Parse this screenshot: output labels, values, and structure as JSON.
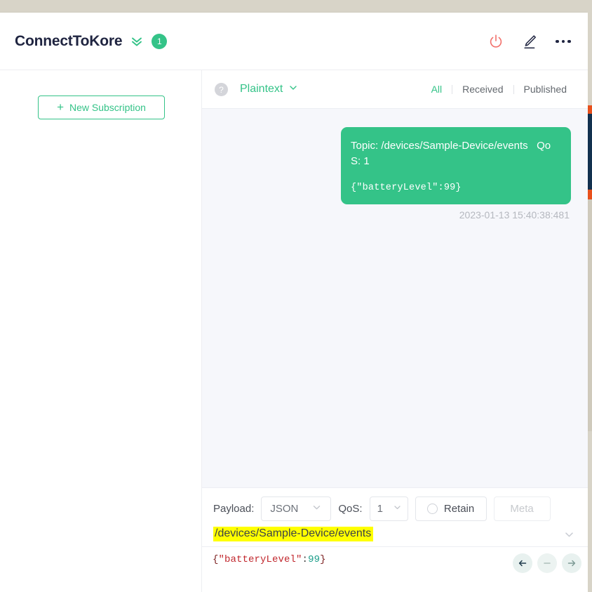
{
  "app": {
    "title": "ConnectToKore",
    "connection_badge": "1",
    "chevron_icon": "double-chevron-down-icon",
    "header_icons": [
      {
        "name": "power-icon",
        "color": "#f2706b"
      },
      {
        "name": "edit-pencil-icon",
        "color": "#1f2440"
      },
      {
        "name": "more-horizontal-icon",
        "color": "#1f2440"
      }
    ]
  },
  "sidebar": {
    "new_subscription_label": "New Subscription",
    "new_subscription_plus": "+"
  },
  "toolbar": {
    "help_icon_glyph": "?",
    "format_label": "Plaintext",
    "format_chevron": "chevron-down-icon",
    "tabs": [
      {
        "label": "All",
        "active": true
      },
      {
        "label": "Received",
        "active": false
      },
      {
        "label": "Published",
        "active": false
      }
    ]
  },
  "messages": [
    {
      "meta": "Topic: /devices/Sample-Device/events   QoS: 1",
      "payload": "{\"batteryLevel\":99}",
      "timestamp": "2023-01-13 15:40:38:481",
      "direction": "published",
      "bubble_color": "#34c388"
    }
  ],
  "composer": {
    "payload_label": "Payload:",
    "payload_value": "JSON",
    "qos_label": "QoS:",
    "qos_value": "1",
    "retain_label": "Retain",
    "retain_checked": false,
    "meta_label": "Meta",
    "topic_value": "/devices/Sample-Device/events",
    "topic_highlight_color": "#ffff00",
    "topic_chevron": "chevron-down-icon",
    "editor": {
      "brace_open": "{",
      "key": "\"batteryLevel\"",
      "colon": ":",
      "number": "99",
      "brace_close": "}"
    },
    "nav_buttons": [
      {
        "name": "send-back-button",
        "glyph": "←"
      },
      {
        "name": "collapse-button",
        "glyph": "−"
      },
      {
        "name": "send-forward-button",
        "glyph": "→"
      }
    ]
  },
  "colors": {
    "accent_green": "#34c388",
    "panel_bg": "#f6f7fb",
    "text_dark": "#1f2440",
    "muted": "#b5b8bf"
  }
}
